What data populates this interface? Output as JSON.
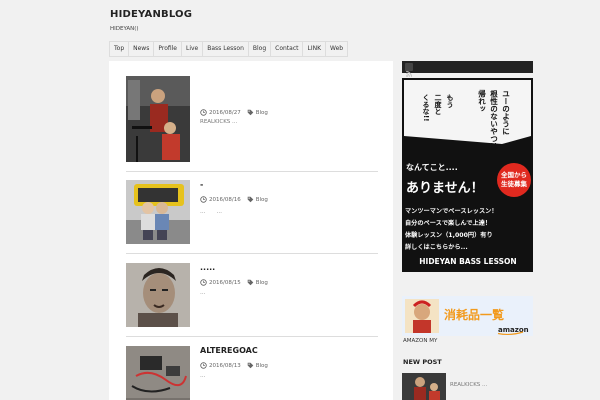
{
  "site": {
    "title": "HIDEYANBLOG",
    "description": "HIDEYAN()"
  },
  "nav": [
    "Top",
    "News",
    "Profile",
    "Live",
    "Bass Lesson",
    "Blog",
    "Contact",
    "LINK",
    "Web"
  ],
  "posts": [
    {
      "title": "",
      "date": "2016/08/27",
      "category": "Blog",
      "excerpt": "REALKICKS ..."
    },
    {
      "title": "-",
      "date": "2016/08/16",
      "category": "Blog",
      "excerpt": "…　　…"
    },
    {
      "title": ".....",
      "date": "2016/08/15",
      "category": "Blog",
      "excerpt": "…"
    },
    {
      "title": "ALTEREGOAC",
      "date": "2016/08/13",
      "category": "Blog",
      "excerpt": "…"
    }
  ],
  "banner": {
    "top_lines": [
      "ユーのように",
      "根性のないやつは",
      "帰れッ"
    ],
    "side_lines": [
      "もう",
      "二度と",
      "くるな!!"
    ],
    "badge": [
      "全国から",
      "生徒募集"
    ],
    "lead": "なんてこと....",
    "headline": "ありません！",
    "body": [
      "マンツーマンでベースレッスン！",
      "自分のペースで楽しんで上達！",
      "体験レッスン（1,000円）有り",
      "詳しくはこちらから..."
    ],
    "footer": "HIDEYAN BASS LESSON"
  },
  "amazon": {
    "text": "消耗品一覧",
    "brand": "amazon",
    "label": "AMAZON MY"
  },
  "new_post": {
    "heading": "NEW POST",
    "excerpt": "REALKICKS ..."
  },
  "icons": {
    "clock": "clock-icon",
    "tag": "tag-icon",
    "rss": "rss-icon"
  },
  "colors": {
    "accent_dark": "#222222",
    "banner_red": "#e0291f",
    "amazon_orange": "#f29a1d"
  }
}
